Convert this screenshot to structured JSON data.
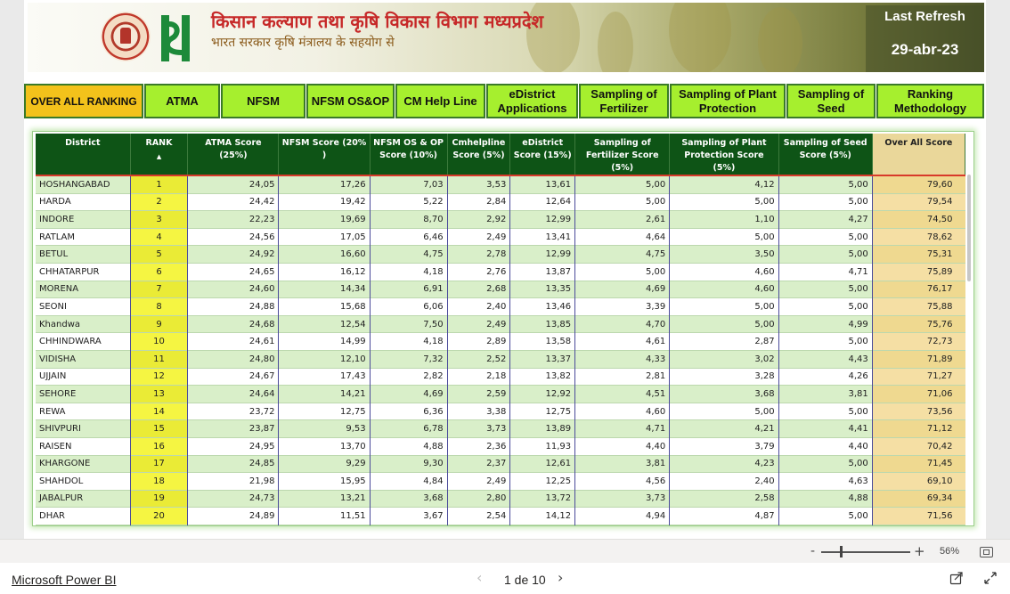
{
  "header": {
    "title": "किसान कल्याण तथा कृषि विकास विभाग मध्यप्रदेश",
    "subtitle": "भारत सरकार कृषि मंत्रालय के सहयोग से",
    "refresh_label": "Last Refresh",
    "refresh_date": "29-abr-23"
  },
  "nav": {
    "items": [
      {
        "label": "OVER ALL RANKING",
        "active": true
      },
      {
        "label": "ATMA"
      },
      {
        "label": "NFSM"
      },
      {
        "label": "NFSM OS&OP"
      },
      {
        "label": "CM Help Line"
      },
      {
        "label": "eDistrict\nApplications"
      },
      {
        "label": "Sampling of\nFertilizer"
      },
      {
        "label": "Sampling of Plant\nProtection"
      },
      {
        "label": "Sampling of\nSeed"
      },
      {
        "label": "Ranking\nMethodology"
      }
    ]
  },
  "table": {
    "columns": [
      "District",
      "RANK",
      "ATMA Score (25%)",
      "NFSM Score (20% )",
      "NFSM OS & OP Score (10%)",
      "Cmhelpline Score (5%)",
      "eDistrict Score (15%)",
      "Sampling of Fertilizer Score (5%)",
      "Sampling of Plant Protection Score (5%)",
      "Sampling of Seed Score (5%)",
      "Over All Score"
    ],
    "sort_indicator": "▲",
    "rows": [
      [
        "HOSHANGABAD",
        "1",
        "24,05",
        "17,26",
        "7,03",
        "3,53",
        "13,61",
        "5,00",
        "4,12",
        "5,00",
        "79,60"
      ],
      [
        "HARDA",
        "2",
        "24,42",
        "19,42",
        "5,22",
        "2,84",
        "12,64",
        "5,00",
        "5,00",
        "5,00",
        "79,54"
      ],
      [
        "INDORE",
        "3",
        "22,23",
        "19,69",
        "8,70",
        "2,92",
        "12,99",
        "2,61",
        "1,10",
        "4,27",
        "74,50"
      ],
      [
        "RATLAM",
        "4",
        "24,56",
        "17,05",
        "6,46",
        "2,49",
        "13,41",
        "4,64",
        "5,00",
        "5,00",
        "78,62"
      ],
      [
        "BETUL",
        "5",
        "24,92",
        "16,60",
        "4,75",
        "2,78",
        "12,99",
        "4,75",
        "3,50",
        "5,00",
        "75,31"
      ],
      [
        "CHHATARPUR",
        "6",
        "24,65",
        "16,12",
        "4,18",
        "2,76",
        "13,87",
        "5,00",
        "4,60",
        "4,71",
        "75,89"
      ],
      [
        "MORENA",
        "7",
        "24,60",
        "14,34",
        "6,91",
        "2,68",
        "13,35",
        "4,69",
        "4,60",
        "5,00",
        "76,17"
      ],
      [
        "SEONI",
        "8",
        "24,88",
        "15,68",
        "6,06",
        "2,40",
        "13,46",
        "3,39",
        "5,00",
        "5,00",
        "75,88"
      ],
      [
        "Khandwa",
        "9",
        "24,68",
        "12,54",
        "7,50",
        "2,49",
        "13,85",
        "4,70",
        "5,00",
        "4,99",
        "75,76"
      ],
      [
        "CHHINDWARA",
        "10",
        "24,61",
        "14,99",
        "4,18",
        "2,89",
        "13,58",
        "4,61",
        "2,87",
        "5,00",
        "72,73"
      ],
      [
        "VIDISHA",
        "11",
        "24,80",
        "12,10",
        "7,32",
        "2,52",
        "13,37",
        "4,33",
        "3,02",
        "4,43",
        "71,89"
      ],
      [
        "UJJAIN",
        "12",
        "24,67",
        "17,43",
        "2,82",
        "2,18",
        "13,82",
        "2,81",
        "3,28",
        "4,26",
        "71,27"
      ],
      [
        "SEHORE",
        "13",
        "24,64",
        "14,21",
        "4,69",
        "2,59",
        "12,92",
        "4,51",
        "3,68",
        "3,81",
        "71,06"
      ],
      [
        "REWA",
        "14",
        "23,72",
        "12,75",
        "6,36",
        "3,38",
        "12,75",
        "4,60",
        "5,00",
        "5,00",
        "73,56"
      ],
      [
        "SHIVPURI",
        "15",
        "23,87",
        "9,53",
        "6,78",
        "3,73",
        "13,89",
        "4,71",
        "4,21",
        "4,41",
        "71,12"
      ],
      [
        "RAISEN",
        "16",
        "24,95",
        "13,70",
        "4,88",
        "2,36",
        "11,93",
        "4,40",
        "3,79",
        "4,40",
        "70,42"
      ],
      [
        "KHARGONE",
        "17",
        "24,85",
        "9,29",
        "9,30",
        "2,37",
        "12,61",
        "3,81",
        "4,23",
        "5,00",
        "71,45"
      ],
      [
        "SHAHDOL",
        "18",
        "21,98",
        "15,95",
        "4,84",
        "2,49",
        "12,25",
        "4,56",
        "2,40",
        "4,63",
        "69,10"
      ],
      [
        "JABALPUR",
        "19",
        "24,73",
        "13,21",
        "3,68",
        "2,80",
        "13,72",
        "3,73",
        "2,58",
        "4,88",
        "69,34"
      ],
      [
        "DHAR",
        "20",
        "24,89",
        "11,51",
        "3,67",
        "2,54",
        "14,12",
        "4,94",
        "4,87",
        "5,00",
        "71,56"
      ]
    ]
  },
  "zoom": {
    "minus": "-",
    "plus": "+",
    "level": "56%",
    "fraction": 0.22
  },
  "footer": {
    "brand_link": "Microsoft Power BI",
    "page_indicator": "1 de 10",
    "prev": "‹",
    "next": "›"
  },
  "colors": {
    "nav_green": "#a6ef2e",
    "nav_active": "#f3c21b",
    "header_green": "#0e5416",
    "rank_yellow": "#f5f542",
    "total_tan": "#f5dfa4",
    "row_alt_green": "#d9efc9"
  },
  "icons": {
    "emblem": "mp-government-emblem",
    "logo": "kisan-logo",
    "share": "share-icon",
    "expand": "fullscreen-icon",
    "fit": "fit-to-page-icon"
  }
}
